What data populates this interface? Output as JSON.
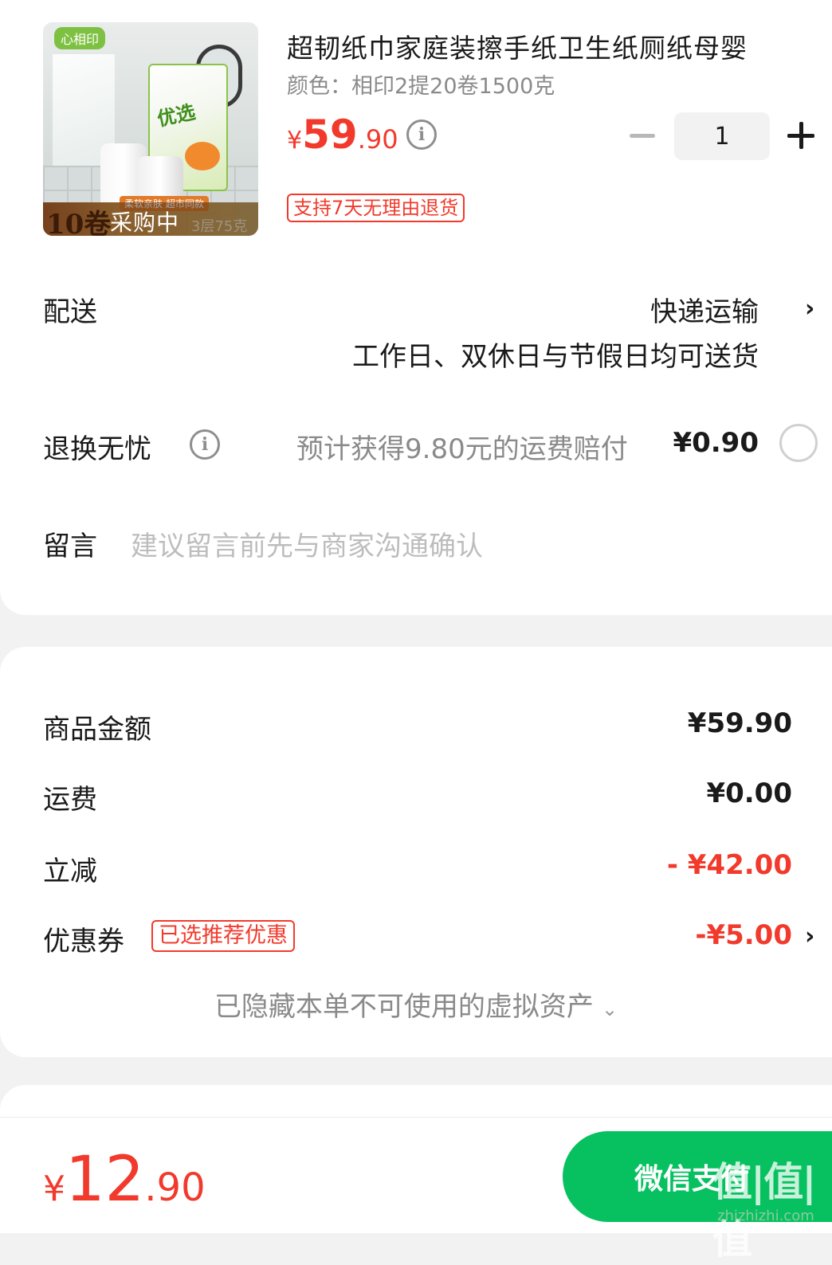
{
  "product": {
    "title": "超韧纸巾家庭装擦手纸卫生纸厕纸母婴",
    "variant": "颜色：相印2提20卷1500克",
    "price_symbol": "¥",
    "price_int": "59",
    "price_dec": ".90",
    "quantity": "1",
    "return_policy": "支持7天无理由退货",
    "image": {
      "brand_logo": "心相印",
      "pack_brand": "优选",
      "strip_tag": "柔软亲肤 超市同款",
      "strip_num": "10卷",
      "strip_sub": "3层75克",
      "status": "采购中"
    }
  },
  "delivery": {
    "label": "配送",
    "method": "快递运输",
    "note": "工作日、双休日与节假日均可送货"
  },
  "return_insurance": {
    "label": "退换无忧",
    "text": "预计获得9.80元的运费赔付",
    "price": "¥0.90"
  },
  "message": {
    "label": "留言",
    "placeholder": "建议留言前先与商家沟通确认"
  },
  "summary": {
    "goods_label": "商品金额",
    "goods_value": "¥59.90",
    "shipping_label": "运费",
    "shipping_value": "¥0.00",
    "discount_label": "立减",
    "discount_value": "- ¥42.00",
    "coupon_label": "优惠券",
    "coupon_tag": "已选推荐优惠",
    "coupon_value": "-¥5.00",
    "hidden_assets": "已隐藏本单不可使用的虚拟资产"
  },
  "footer": {
    "total_symbol": "¥",
    "total_int": "12",
    "total_dec": ".90",
    "pay_label": "微信支付",
    "watermark": "值|值|值",
    "watermark_sub": "zhizhizhi.com"
  },
  "colors": {
    "accent_red": "#f23a2c",
    "wechat_green": "#07c160"
  },
  "icons": {
    "info": "info-circle-icon",
    "chevron": "chevron-right-icon",
    "minus": "minus-icon",
    "plus": "plus-icon",
    "radio": "radio-unchecked-icon",
    "down": "chevron-down-icon"
  }
}
